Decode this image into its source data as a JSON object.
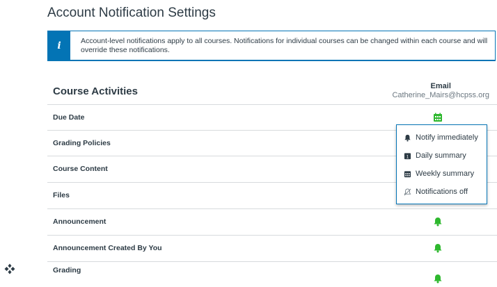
{
  "page": {
    "title": "Account Notification Settings",
    "info": "Account-level notifications apply to all courses. Notifications for individual courses can be changed within each course and will override these notifications.",
    "info_icon": "i"
  },
  "table": {
    "section_title": "Course Activities",
    "column_title": "Email",
    "column_email": "Catherine_Mairs@hcpss.org",
    "rows": [
      {
        "label": "Due Date",
        "setting": "weekly-summary"
      },
      {
        "label": "Grading Policies",
        "setting": "notify-immediately"
      },
      {
        "label": "Course Content",
        "setting": "notify-immediately"
      },
      {
        "label": "Files",
        "setting": "notify-immediately"
      },
      {
        "label": "Announcement",
        "setting": "notify-immediately"
      },
      {
        "label": "Announcement Created By You",
        "setting": "notify-immediately"
      },
      {
        "label": "Grading",
        "setting": "notify-immediately"
      }
    ]
  },
  "menu": {
    "items": [
      {
        "label": "Notify immediately",
        "icon": "bell-icon"
      },
      {
        "label": "Daily summary",
        "icon": "calendar-day-icon"
      },
      {
        "label": "Weekly summary",
        "icon": "calendar-week-icon"
      },
      {
        "label": "Notifications off",
        "icon": "bell-off-icon"
      }
    ]
  },
  "colors": {
    "accent": "#0374b5",
    "green": "#2eb82e",
    "text": "#2d3b45"
  }
}
